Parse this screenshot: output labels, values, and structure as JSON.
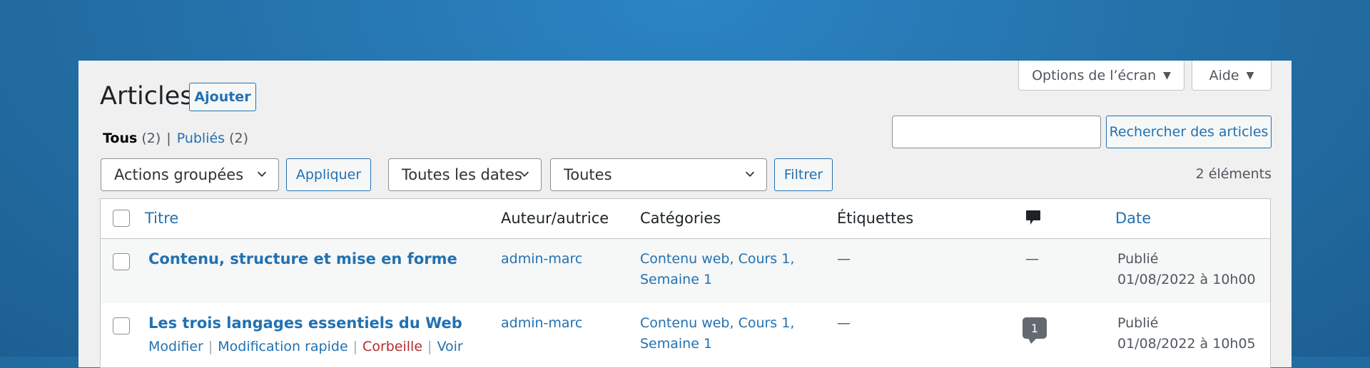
{
  "screen_meta": {
    "screen_options_label": "Options de l’écran",
    "help_label": "Aide"
  },
  "header": {
    "title": "Articles",
    "add_label": "Ajouter"
  },
  "views": {
    "all_label": "Tous",
    "all_count": "(2)",
    "separator": "|",
    "published_label": "Publiés",
    "published_count": "(2)"
  },
  "search": {
    "value": "",
    "button_label": "Rechercher des articles"
  },
  "filters": {
    "bulk_actions": "Actions groupées",
    "apply_label": "Appliquer",
    "dates": "Toutes les dates",
    "categories": "Toutes",
    "filter_label": "Filtrer"
  },
  "items_count": "2 éléments",
  "table": {
    "columns": {
      "title": "Titre",
      "author": "Auteur/autrice",
      "categories": "Catégories",
      "tags": "Étiquettes",
      "comments_icon": "comment-bubble-icon",
      "date": "Date"
    },
    "rows": [
      {
        "title": "Contenu, structure et mise en forme",
        "author": "admin-marc",
        "categories_line1": "Contenu web, Cours 1,",
        "categories_line2": "Semaine 1",
        "tags": "—",
        "comments": "—",
        "status": "Publié",
        "date": "01/08/2022 à 10h00"
      },
      {
        "title": "Les trois langages essentiels du Web",
        "author": "admin-marc",
        "categories_line1": "Contenu web, Cours 1,",
        "categories_line2": "Semaine 1",
        "tags": "—",
        "comments": "1",
        "status": "Publié",
        "date": "01/08/2022 à 10h05",
        "actions": {
          "edit": "Modifier",
          "quick_edit": "Modification rapide",
          "trash": "Corbeille",
          "view": "Voir",
          "sep": "|"
        }
      }
    ]
  },
  "colors": {
    "accent": "#2271b1",
    "trash": "#b32d2e",
    "background_top": "#2b84c4"
  }
}
